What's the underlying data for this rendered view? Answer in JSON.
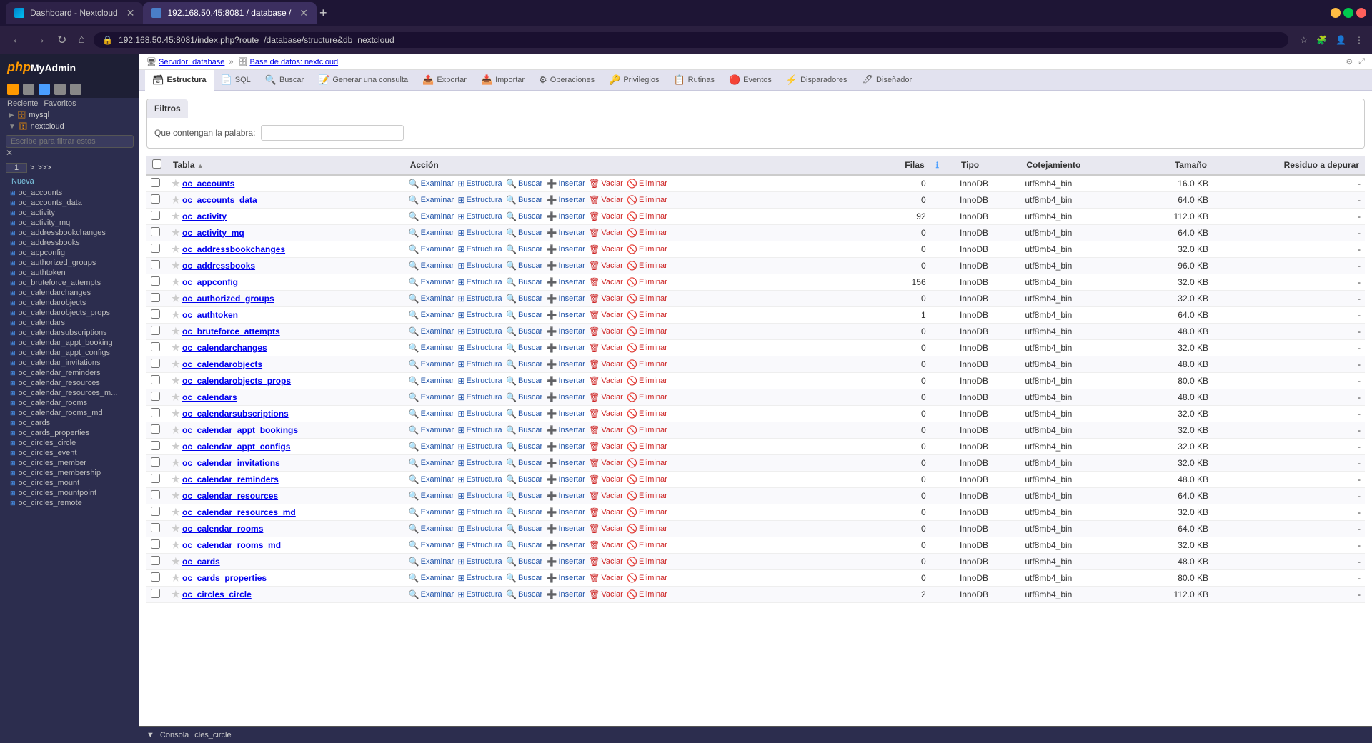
{
  "browser": {
    "tabs": [
      {
        "id": "tab1",
        "label": "Dashboard - Nextcloud",
        "type": "nextcloud",
        "active": false
      },
      {
        "id": "tab2",
        "label": "192.168.50.45:8081 / database /",
        "type": "pma",
        "active": true
      }
    ],
    "address": "192.168.50.45:8081/index.php?route=/database/structure&db=nextcloud",
    "add_tab": "+"
  },
  "breadcrumb": {
    "server": "Servidor: database",
    "sep1": "»",
    "db": "Base de datos: nextcloud"
  },
  "tabs": [
    {
      "id": "estructura",
      "label": "Estructura",
      "icon": "🗃",
      "active": true
    },
    {
      "id": "sql",
      "label": "SQL",
      "icon": "📄",
      "active": false
    },
    {
      "id": "buscar",
      "label": "Buscar",
      "icon": "🔍",
      "active": false
    },
    {
      "id": "generar",
      "label": "Generar una consulta",
      "icon": "📝",
      "active": false
    },
    {
      "id": "exportar",
      "label": "Exportar",
      "icon": "📤",
      "active": false
    },
    {
      "id": "importar",
      "label": "Importar",
      "icon": "📥",
      "active": false
    },
    {
      "id": "operaciones",
      "label": "Operaciones",
      "icon": "⚙",
      "active": false
    },
    {
      "id": "privilegios",
      "label": "Privilegios",
      "icon": "🔑",
      "active": false
    },
    {
      "id": "rutinas",
      "label": "Rutinas",
      "icon": "📋",
      "active": false
    },
    {
      "id": "eventos",
      "label": "Eventos",
      "icon": "🔴",
      "active": false
    },
    {
      "id": "disparadores",
      "label": "Disparadores",
      "icon": "⚡",
      "active": false
    },
    {
      "id": "disenador",
      "label": "Diseñador",
      "icon": "🖊",
      "active": false
    }
  ],
  "filtros": {
    "header": "Filtros",
    "label": "Que contengan la palabra:",
    "placeholder": ""
  },
  "table_headers": [
    {
      "id": "tabla",
      "label": "Tabla",
      "sortable": true
    },
    {
      "id": "accion",
      "label": "Acción",
      "sortable": false
    },
    {
      "id": "filas",
      "label": "Filas",
      "sortable": false
    },
    {
      "id": "info",
      "label": "ℹ",
      "sortable": false
    },
    {
      "id": "tipo",
      "label": "Tipo",
      "sortable": false
    },
    {
      "id": "cotejamiento",
      "label": "Cotejamiento",
      "sortable": false
    },
    {
      "id": "tamano",
      "label": "Tamaño",
      "sortable": false
    },
    {
      "id": "residuo",
      "label": "Residuo a depurar",
      "sortable": false
    }
  ],
  "tables": [
    {
      "name": "oc_accounts",
      "rows": 0,
      "type": "InnoDB",
      "collation": "utf8mb4_bin",
      "size": "16.0 KB",
      "residue": "-"
    },
    {
      "name": "oc_accounts_data",
      "rows": 0,
      "type": "InnoDB",
      "collation": "utf8mb4_bin",
      "size": "64.0 KB",
      "residue": "-"
    },
    {
      "name": "oc_activity",
      "rows": 92,
      "type": "InnoDB",
      "collation": "utf8mb4_bin",
      "size": "112.0 KB",
      "residue": "-"
    },
    {
      "name": "oc_activity_mq",
      "rows": 0,
      "type": "InnoDB",
      "collation": "utf8mb4_bin",
      "size": "64.0 KB",
      "residue": "-"
    },
    {
      "name": "oc_addressbookchanges",
      "rows": 0,
      "type": "InnoDB",
      "collation": "utf8mb4_bin",
      "size": "32.0 KB",
      "residue": "-"
    },
    {
      "name": "oc_addressbooks",
      "rows": 0,
      "type": "InnoDB",
      "collation": "utf8mb4_bin",
      "size": "96.0 KB",
      "residue": "-"
    },
    {
      "name": "oc_appconfig",
      "rows": 156,
      "type": "InnoDB",
      "collation": "utf8mb4_bin",
      "size": "32.0 KB",
      "residue": "-"
    },
    {
      "name": "oc_authorized_groups",
      "rows": 0,
      "type": "InnoDB",
      "collation": "utf8mb4_bin",
      "size": "32.0 KB",
      "residue": "-"
    },
    {
      "name": "oc_authtoken",
      "rows": 1,
      "type": "InnoDB",
      "collation": "utf8mb4_bin",
      "size": "64.0 KB",
      "residue": "-"
    },
    {
      "name": "oc_bruteforce_attempts",
      "rows": 0,
      "type": "InnoDB",
      "collation": "utf8mb4_bin",
      "size": "48.0 KB",
      "residue": "-"
    },
    {
      "name": "oc_calendarchanges",
      "rows": 0,
      "type": "InnoDB",
      "collation": "utf8mb4_bin",
      "size": "32.0 KB",
      "residue": "-"
    },
    {
      "name": "oc_calendarobjects",
      "rows": 0,
      "type": "InnoDB",
      "collation": "utf8mb4_bin",
      "size": "48.0 KB",
      "residue": "-"
    },
    {
      "name": "oc_calendarobjects_props",
      "rows": 0,
      "type": "InnoDB",
      "collation": "utf8mb4_bin",
      "size": "80.0 KB",
      "residue": "-"
    },
    {
      "name": "oc_calendars",
      "rows": 0,
      "type": "InnoDB",
      "collation": "utf8mb4_bin",
      "size": "48.0 KB",
      "residue": "-"
    },
    {
      "name": "oc_calendarsubscriptions",
      "rows": 0,
      "type": "InnoDB",
      "collation": "utf8mb4_bin",
      "size": "32.0 KB",
      "residue": "-"
    },
    {
      "name": "oc_calendar_appt_bookings",
      "rows": 0,
      "type": "InnoDB",
      "collation": "utf8mb4_bin",
      "size": "32.0 KB",
      "residue": "-"
    },
    {
      "name": "oc_calendar_appt_configs",
      "rows": 0,
      "type": "InnoDB",
      "collation": "utf8mb4_bin",
      "size": "32.0 KB",
      "residue": "-"
    },
    {
      "name": "oc_calendar_invitations",
      "rows": 0,
      "type": "InnoDB",
      "collation": "utf8mb4_bin",
      "size": "32.0 KB",
      "residue": "-"
    },
    {
      "name": "oc_calendar_reminders",
      "rows": 0,
      "type": "InnoDB",
      "collation": "utf8mb4_bin",
      "size": "48.0 KB",
      "residue": "-"
    },
    {
      "name": "oc_calendar_resources",
      "rows": 0,
      "type": "InnoDB",
      "collation": "utf8mb4_bin",
      "size": "64.0 KB",
      "residue": "-"
    },
    {
      "name": "oc_calendar_resources_md",
      "rows": 0,
      "type": "InnoDB",
      "collation": "utf8mb4_bin",
      "size": "32.0 KB",
      "residue": "-"
    },
    {
      "name": "oc_calendar_rooms",
      "rows": 0,
      "type": "InnoDB",
      "collation": "utf8mb4_bin",
      "size": "64.0 KB",
      "residue": "-"
    },
    {
      "name": "oc_calendar_rooms_md",
      "rows": 0,
      "type": "InnoDB",
      "collation": "utf8mb4_bin",
      "size": "32.0 KB",
      "residue": "-"
    },
    {
      "name": "oc_cards",
      "rows": 0,
      "type": "InnoDB",
      "collation": "utf8mb4_bin",
      "size": "48.0 KB",
      "residue": "-"
    },
    {
      "name": "oc_cards_properties",
      "rows": 0,
      "type": "InnoDB",
      "collation": "utf8mb4_bin",
      "size": "80.0 KB",
      "residue": "-"
    },
    {
      "name": "oc_circles_circle",
      "rows": 2,
      "type": "InnoDB",
      "collation": "utf8mb4_bin",
      "size": "112.0 KB",
      "residue": "-"
    }
  ],
  "sidebar": {
    "logo_php": "php",
    "logo_myadmin": "MyAdmin",
    "recent_label": "Reciente",
    "favorites_label": "Favoritos",
    "filter_placeholder": "Escribe para filtrar estos",
    "page_num": "1",
    "databases": [
      {
        "name": "mysql",
        "type": "db"
      },
      {
        "name": "nextcloud",
        "type": "db",
        "expanded": true
      }
    ],
    "tables": [
      "Nueva",
      "oc_accounts",
      "oc_accounts_data",
      "oc_activity",
      "oc_activity_mq",
      "oc_addressbookchanges",
      "oc_addressbooks",
      "oc_appconfig",
      "oc_authorized_groups",
      "oc_authtoken",
      "oc_bruteforce_attempts",
      "oc_calendarchanges",
      "oc_calendarobjects",
      "oc_calendarobjects_props",
      "oc_calendars",
      "oc_calendarsubscriptions",
      "oc_calendar_appt_booking",
      "oc_calendar_appt_configs",
      "oc_calendar_invitations",
      "oc_calendar_reminders",
      "oc_calendar_resources",
      "oc_calendar_resources_m...",
      "oc_calendar_rooms",
      "oc_calendar_rooms_md",
      "oc_cards",
      "oc_cards_properties",
      "oc_circles_circle",
      "oc_circles_event",
      "oc_circles_member",
      "oc_circles_membership",
      "oc_circles_mount",
      "oc_circles_mountpoint",
      "oc_circles_remote"
    ]
  },
  "actions": {
    "examinar": "Examinar",
    "estructura": "Estructura",
    "buscar": "Buscar",
    "insertar": "Insertar",
    "vaciar": "Vaciar",
    "eliminar": "Eliminar"
  },
  "console": {
    "label": "Consola",
    "table": "cles_circle"
  }
}
